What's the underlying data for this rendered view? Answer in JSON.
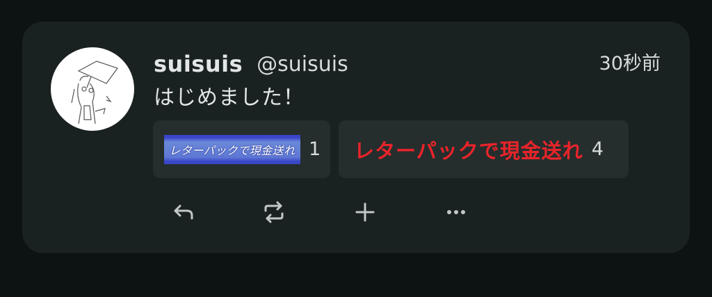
{
  "post": {
    "display_name": "suisuis",
    "handle": "@suisuis",
    "timestamp": "30秒前",
    "text": "はじめました！"
  },
  "reactions": [
    {
      "label": "レターパックで現金送れ",
      "style": "image",
      "count": "1"
    },
    {
      "label": "レターパックで現金送れ",
      "style": "text",
      "count": "4"
    }
  ],
  "actions": [
    "reply-icon",
    "renote-icon",
    "add-reaction-icon",
    "more-icon"
  ],
  "colors": {
    "background": "#0d1212",
    "card": "#1a2221",
    "reaction_bg": "#252e2d",
    "emoji_red": "#e8242a",
    "emoji_blue": "#5e78d4"
  }
}
